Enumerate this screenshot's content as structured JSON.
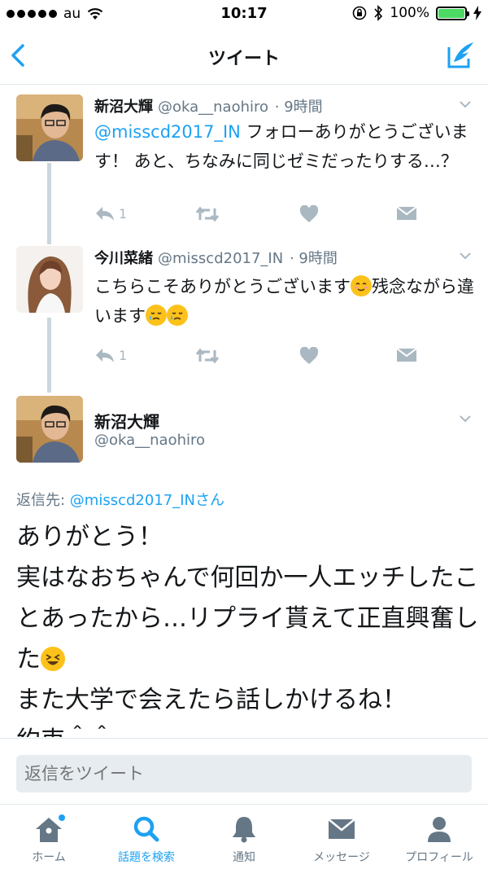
{
  "status_bar": {
    "carrier": "au",
    "time": "10:17",
    "battery": "100%",
    "battery_level": 1.0
  },
  "nav": {
    "title": "ツイート",
    "back_icon": "chevron-left-icon",
    "compose_icon": "compose-tweet-icon"
  },
  "tweets": [
    {
      "name": "新沼大輝",
      "handle": "@oka__naohiro",
      "time": "· 9時間",
      "mention": "@misscd2017_IN",
      "text": " フォローありがとうございます！ あと、ちなみに同じゼミだったりする…？",
      "reply_count": "1"
    },
    {
      "name": "今川菜緒",
      "handle": "@misscd2017_IN",
      "time": "· 9時間",
      "text_part1": "こちらこそありがとうございます",
      "text_part2": "残念ながら違います",
      "reply_count": "1"
    }
  ],
  "main_tweet": {
    "name": "新沼大輝",
    "handle": "@oka__naohiro",
    "reply_prefix": "返信先: ",
    "reply_mention": "@misscd2017_INさん",
    "line1": "ありがとう！",
    "line2": "実はなおちゃんで何回か一人エッチしたことあったから…リプライ貰えて正直興奮した",
    "line3": "また大学で会えたら話しかけるね！",
    "line4": "約束＾＾"
  },
  "reply_box": {
    "placeholder": "返信をツイート"
  },
  "tabs": [
    {
      "label": "ホーム",
      "icon": "home-icon",
      "badge": true
    },
    {
      "label": "話題を検索",
      "icon": "search-icon",
      "active": true
    },
    {
      "label": "通知",
      "icon": "bell-icon"
    },
    {
      "label": "メッセージ",
      "icon": "envelope-icon"
    },
    {
      "label": "プロフィール",
      "icon": "person-icon"
    }
  ],
  "colors": {
    "accent": "#1da1f2",
    "muted": "#657786",
    "action": "#aab8c2",
    "thread_line": "#ccd6dd"
  }
}
